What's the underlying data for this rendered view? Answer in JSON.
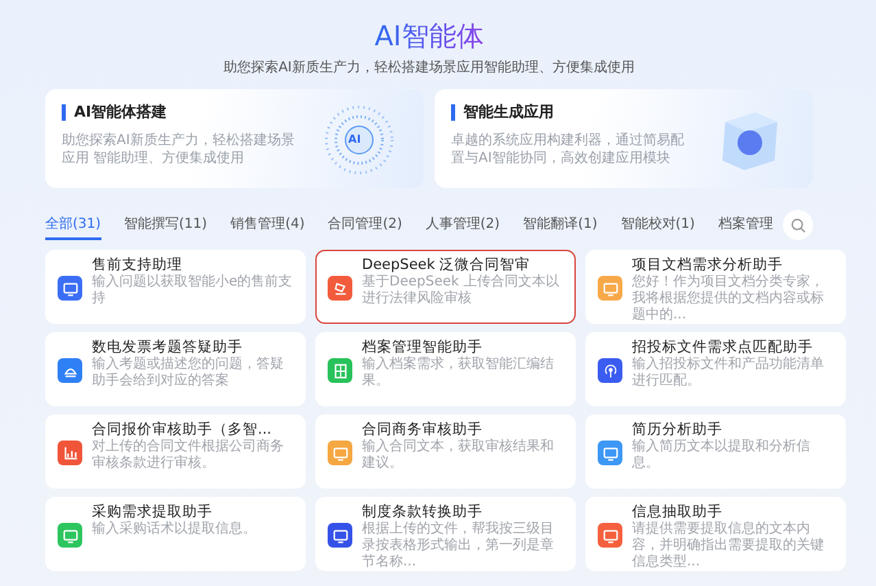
{
  "header": {
    "title": "AI智能体",
    "subtitle": "助您探索AI新质生产力，轻松搭建场景应用智能助理、方便集成使用"
  },
  "features": [
    {
      "title": "AI智能体搭建",
      "description": "助您探索AI新质生产力，轻松搭建场景应用 智能助理、方便集成使用",
      "kind": "orb",
      "badge": "AI"
    },
    {
      "title": "智能生成应用",
      "description": "卓越的系统应用构建利器，通过简易配置与AI智能协同，高效创建应用模块",
      "kind": "cube"
    }
  ],
  "tabs": [
    {
      "label": "全部(31)",
      "selected": true
    },
    {
      "label": "智能撰写(11)",
      "selected": false
    },
    {
      "label": "销售管理(4)",
      "selected": false
    },
    {
      "label": "合同管理(2)",
      "selected": false
    },
    {
      "label": "人事管理(2)",
      "selected": false
    },
    {
      "label": "智能翻译(1)",
      "selected": false
    },
    {
      "label": "智能校对(1)",
      "selected": false
    },
    {
      "label": "档案管理",
      "selected": false
    }
  ],
  "agents": [
    {
      "title": "售前支持助理",
      "description": "输入问题以获取智能小e的售前支持",
      "color": "#3b6ef5",
      "kind": "monitor",
      "selected": false
    },
    {
      "title": "DeepSeek 泛微合同智审",
      "description": "基于DeepSeek 上传合同文本以进行法律风险审核",
      "color": "#f25c3c",
      "kind": "stamp",
      "selected": true
    },
    {
      "title": "项目文档需求分析助手",
      "description": "您好！作为项目文档分类专家，我将根据您提供的文档内容或标题中的...",
      "color": "#f7a94a",
      "kind": "monitor",
      "selected": false
    },
    {
      "title": "数电发票考题答疑助手",
      "description": "输入考题或描述您的问题，答疑助手会给到对应的答案",
      "color": "#2f80f5",
      "kind": "hat",
      "selected": false
    },
    {
      "title": "档案管理智能助手",
      "description": "输入档案需求，获取智能汇编结果。",
      "color": "#27c25b",
      "kind": "grid",
      "selected": false
    },
    {
      "title": "招投标文件需求点匹配助手",
      "description": "输入招投标文件和产品功能清单进行匹配。",
      "color": "#3b5cf0",
      "kind": "signal",
      "selected": false
    },
    {
      "title": "合同报价审核助手（多智...",
      "description": "对上传的合同文件根据公司商务审核条款进行审核。",
      "color": "#f0553a",
      "kind": "chart",
      "selected": false
    },
    {
      "title": "合同商务审核助手",
      "description": "输入合同文本，获取审核结果和建议。",
      "color": "#f5a742",
      "kind": "monitor",
      "selected": false
    },
    {
      "title": "简历分析助手",
      "description": "输入简历文本以提取和分析信息。",
      "color": "#3c97f5",
      "kind": "monitor",
      "selected": false
    },
    {
      "title": "采购需求提取助手",
      "description": "输入采购话术以提取信息。",
      "color": "#2dc55e",
      "kind": "monitor",
      "selected": false
    },
    {
      "title": "制度条款转换助手",
      "description": "根据上传的文件，帮我按三级目录按表格形式输出，第一列是章节名称...",
      "color": "#3552e8",
      "kind": "monitor",
      "selected": false
    },
    {
      "title": "信息抽取助手",
      "description": "请提供需要提取信息的文本内容，并明确指出需要提取的关键信息类型...",
      "color": "#f5603f",
      "kind": "monitor",
      "selected": false
    }
  ]
}
